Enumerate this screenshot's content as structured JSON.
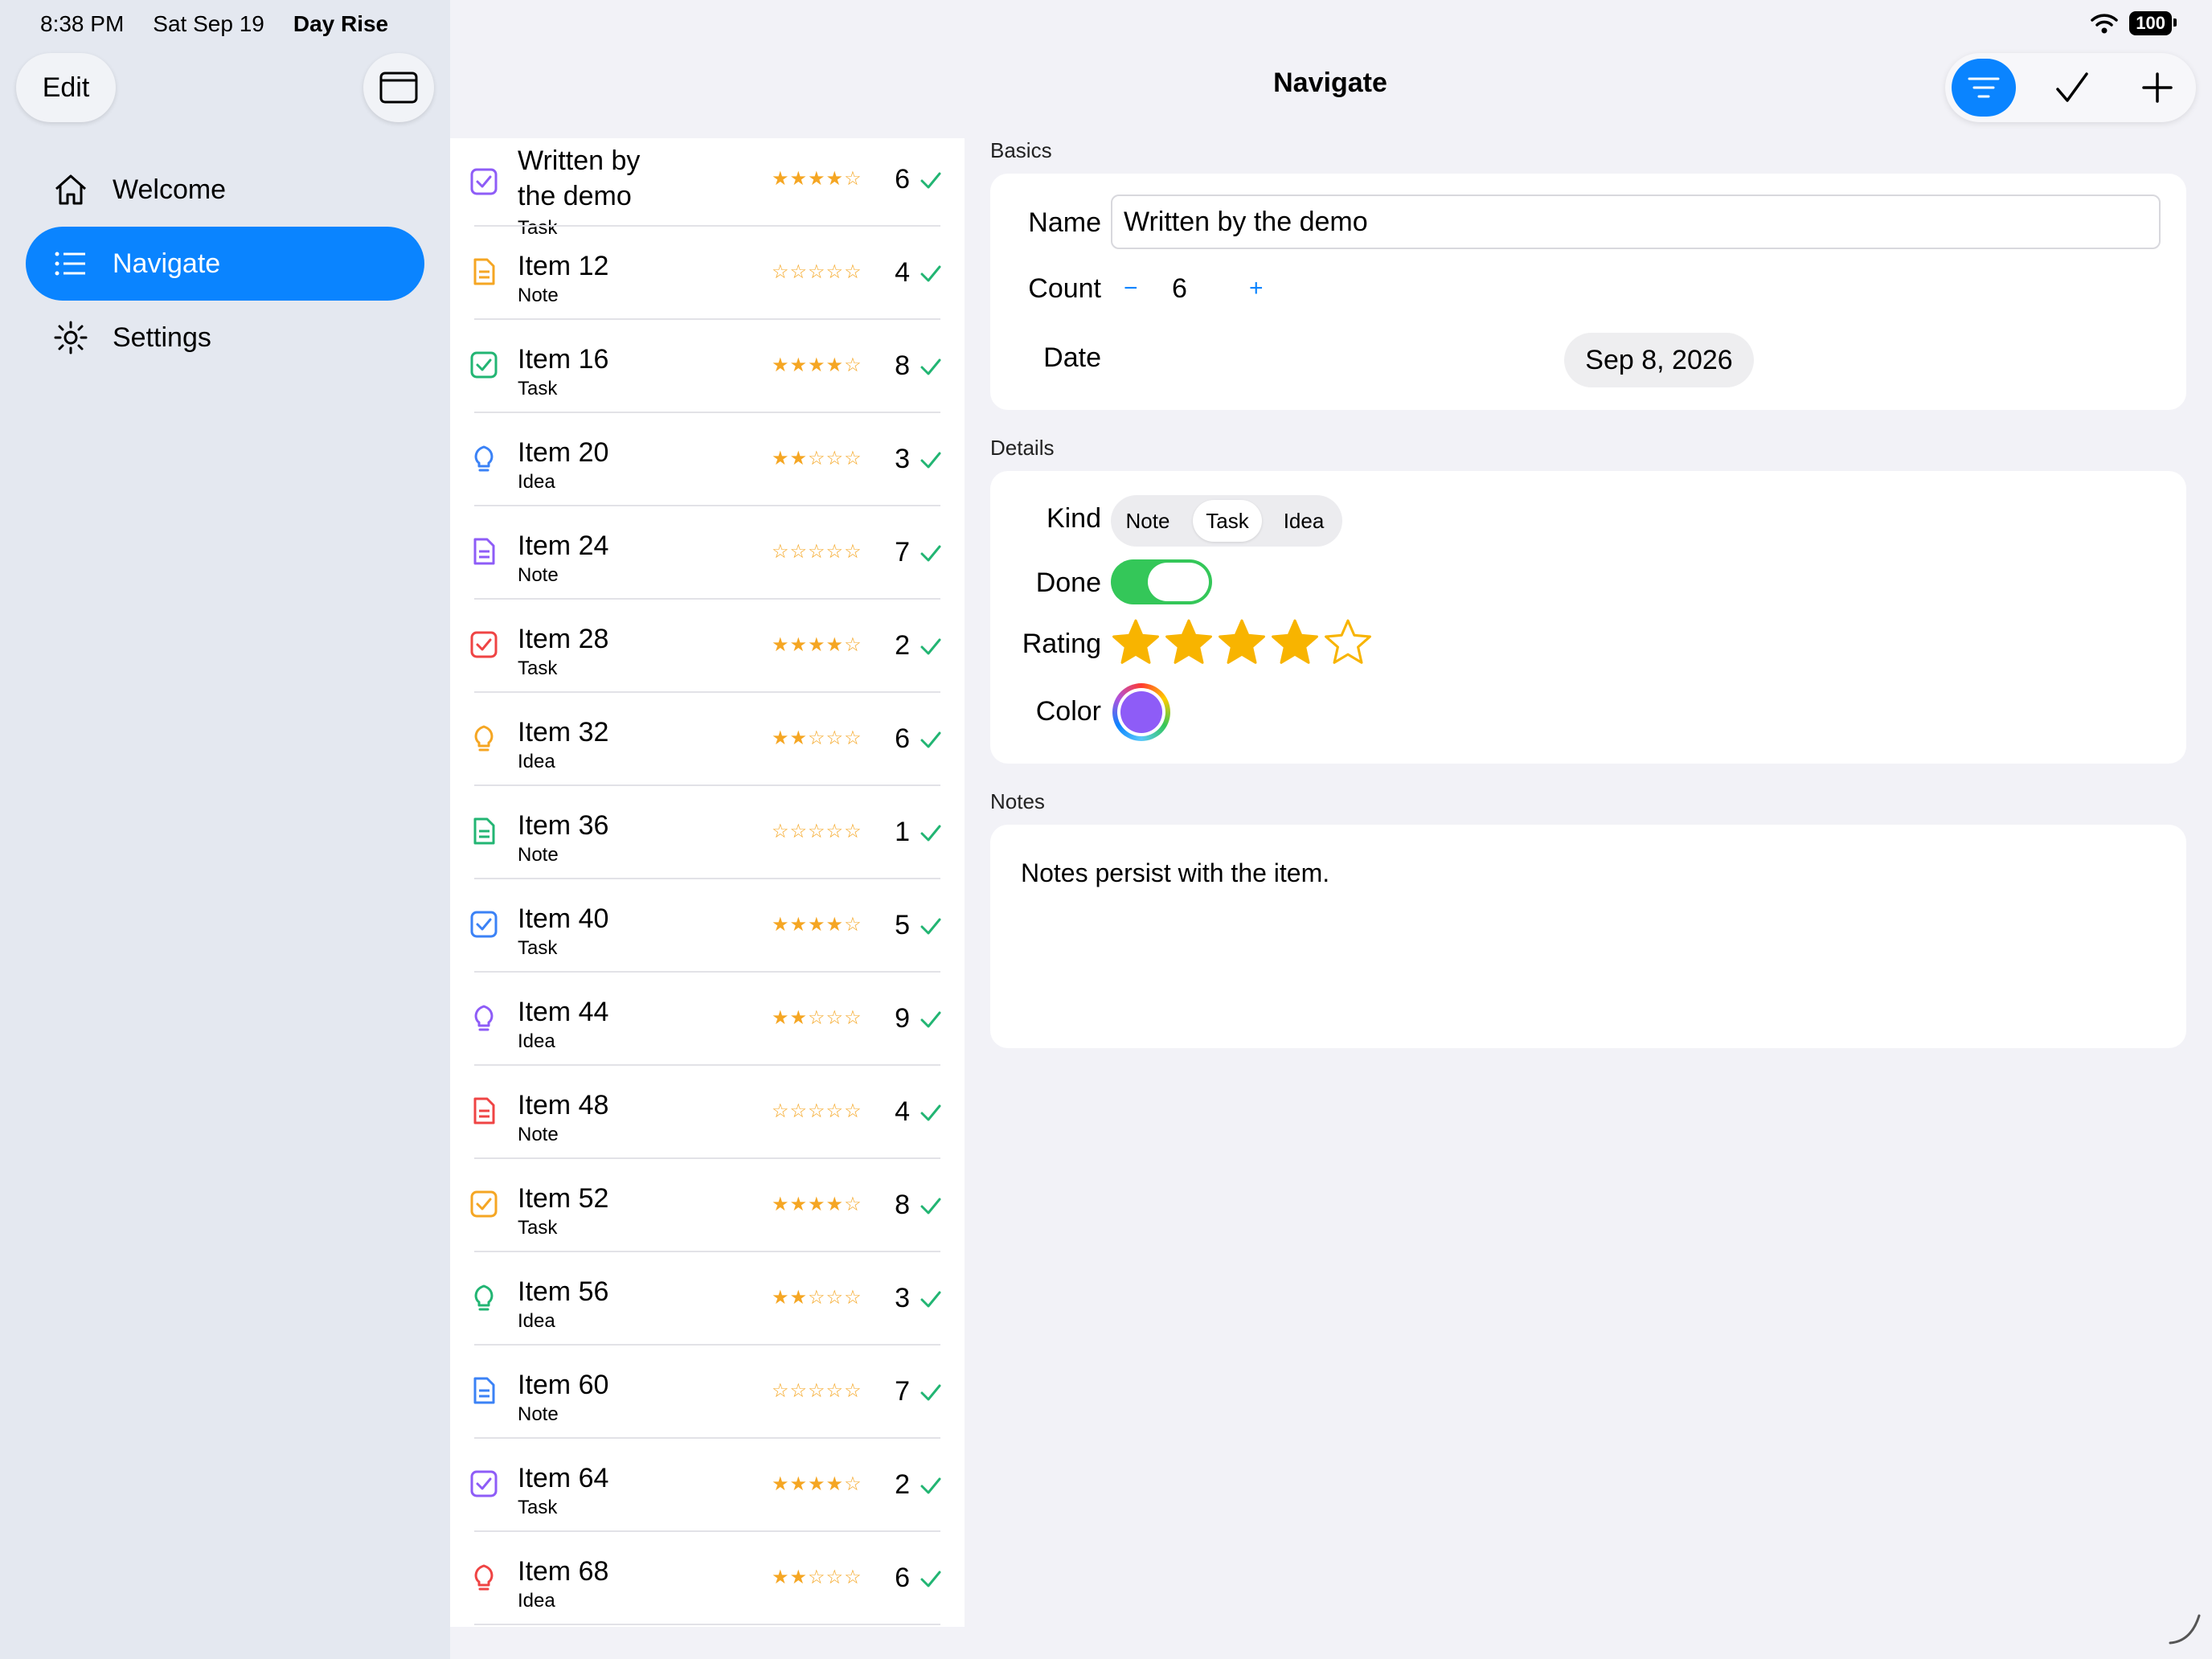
{
  "status_bar": {
    "time": "8:38 PM",
    "date": "Sat Sep 19",
    "app": "Day Rise",
    "battery": "100"
  },
  "sidebar": {
    "edit_label": "Edit",
    "items": [
      {
        "label": "Welcome",
        "icon": "house-icon"
      },
      {
        "label": "Navigate",
        "icon": "list-icon",
        "active": true
      },
      {
        "label": "Settings",
        "icon": "sun-gear-icon"
      }
    ]
  },
  "header": {
    "title": "Navigate"
  },
  "toolbar": {
    "icons": [
      "filter-icon",
      "checkmark-icon",
      "plus-icon"
    ],
    "accent": "#0a84ff"
  },
  "list": {
    "items": [
      {
        "title": "Written by the demo",
        "kind": "Task",
        "stars": "★★★★☆",
        "count": "6",
        "icon": "checkbox-icon",
        "color": "#8e5cf7"
      },
      {
        "title": "Item 12",
        "kind": "Note",
        "stars": "☆☆☆☆☆",
        "count": "4",
        "icon": "note-icon",
        "color": "#f5a623"
      },
      {
        "title": "Item 16",
        "kind": "Task",
        "stars": "★★★★☆",
        "count": "8",
        "icon": "checkbox-icon",
        "color": "#22b573"
      },
      {
        "title": "Item 20",
        "kind": "Idea",
        "stars": "★★☆☆☆",
        "count": "3",
        "icon": "lightbulb-icon",
        "color": "#3b82f6"
      },
      {
        "title": "Item 24",
        "kind": "Note",
        "stars": "☆☆☆☆☆",
        "count": "7",
        "icon": "note-icon",
        "color": "#8e5cf7"
      },
      {
        "title": "Item 28",
        "kind": "Task",
        "stars": "★★★★☆",
        "count": "2",
        "icon": "checkbox-icon",
        "color": "#ef4444"
      },
      {
        "title": "Item 32",
        "kind": "Idea",
        "stars": "★★☆☆☆",
        "count": "6",
        "icon": "lightbulb-icon",
        "color": "#f5a623"
      },
      {
        "title": "Item 36",
        "kind": "Note",
        "stars": "☆☆☆☆☆",
        "count": "1",
        "icon": "note-icon",
        "color": "#22b573"
      },
      {
        "title": "Item 40",
        "kind": "Task",
        "stars": "★★★★☆",
        "count": "5",
        "icon": "checkbox-icon",
        "color": "#3b82f6"
      },
      {
        "title": "Item 44",
        "kind": "Idea",
        "stars": "★★☆☆☆",
        "count": "9",
        "icon": "lightbulb-icon",
        "color": "#8e5cf7"
      },
      {
        "title": "Item 48",
        "kind": "Note",
        "stars": "☆☆☆☆☆",
        "count": "4",
        "icon": "note-icon",
        "color": "#ef4444"
      },
      {
        "title": "Item 52",
        "kind": "Task",
        "stars": "★★★★☆",
        "count": "8",
        "icon": "checkbox-icon",
        "color": "#f5a623"
      },
      {
        "title": "Item 56",
        "kind": "Idea",
        "stars": "★★☆☆☆",
        "count": "3",
        "icon": "lightbulb-icon",
        "color": "#22b573"
      },
      {
        "title": "Item 60",
        "kind": "Note",
        "stars": "☆☆☆☆☆",
        "count": "7",
        "icon": "note-icon",
        "color": "#3b82f6"
      },
      {
        "title": "Item 64",
        "kind": "Task",
        "stars": "★★★★☆",
        "count": "2",
        "icon": "checkbox-icon",
        "color": "#8e5cf7"
      },
      {
        "title": "Item 68",
        "kind": "Idea",
        "stars": "★★☆☆☆",
        "count": "6",
        "icon": "lightbulb-icon",
        "color": "#ef4444"
      }
    ],
    "check_color": "#22b573"
  },
  "detail": {
    "basics_header": "Basics",
    "name_label": "Name",
    "name_value": "Written by the demo",
    "count_label": "Count",
    "count_minus": "−",
    "count_value": "6",
    "count_plus": "+",
    "date_label": "Date",
    "date_value": "Sep 8, 2026",
    "details_header": "Details",
    "kind_label": "Kind",
    "kind_options": [
      "Note",
      "Task",
      "Idea"
    ],
    "kind_selected": "Task",
    "done_label": "Done",
    "done_value": true,
    "rating_label": "Rating",
    "rating_value": 4,
    "rating_max": 5,
    "color_label": "Color",
    "color_value": "#8e5cf7",
    "notes_header": "Notes",
    "notes_value": "Notes persist with the item."
  }
}
